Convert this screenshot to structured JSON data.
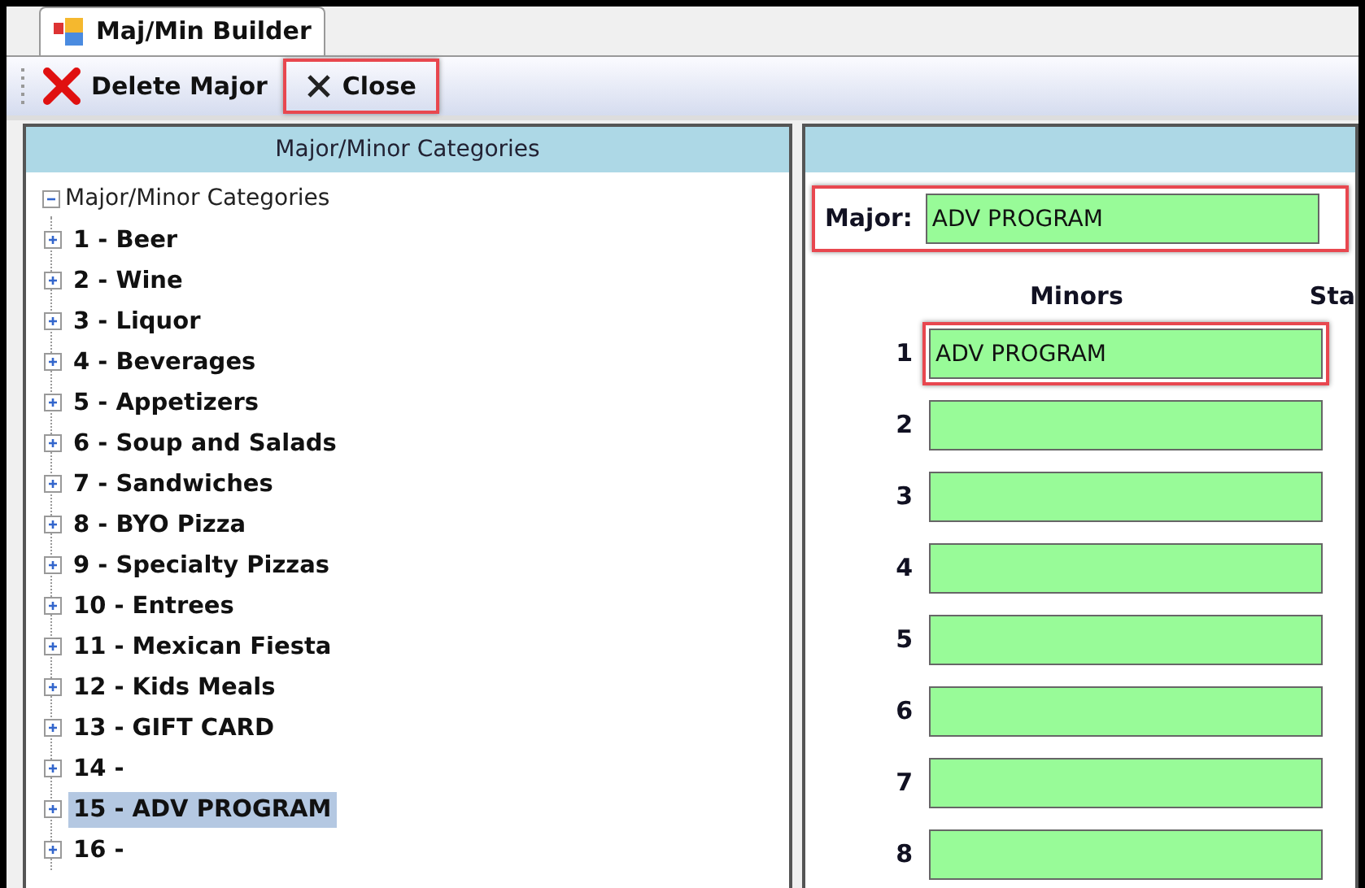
{
  "window": {
    "tab": {
      "title": "Maj/Min Builder",
      "selected": true
    }
  },
  "toolbar": {
    "buttons": [
      {
        "label": "Delete Major",
        "kind": "delete",
        "highlighted": false
      },
      {
        "label": "Close",
        "kind": "close",
        "highlighted": true
      }
    ]
  },
  "tree_panel": {
    "header": "Major/Minor Categories",
    "root": {
      "label": "Major/Minor Categories",
      "expanded": true,
      "children": [
        {
          "label": "1 - Beer",
          "expanded": false,
          "selected": false
        },
        {
          "label": "2 - Wine",
          "expanded": false,
          "selected": false
        },
        {
          "label": "3 - Liquor",
          "expanded": false,
          "selected": false
        },
        {
          "label": "4 - Beverages",
          "expanded": false,
          "selected": false
        },
        {
          "label": "5 - Appetizers",
          "expanded": false,
          "selected": false
        },
        {
          "label": "6 - Soup and Salads",
          "expanded": false,
          "selected": false
        },
        {
          "label": "7 - Sandwiches",
          "expanded": false,
          "selected": false
        },
        {
          "label": "8 - BYO Pizza",
          "expanded": false,
          "selected": false
        },
        {
          "label": "9 - Specialty Pizzas",
          "expanded": false,
          "selected": false
        },
        {
          "label": "10 - Entrees",
          "expanded": false,
          "selected": false
        },
        {
          "label": "11 - Mexican Fiesta",
          "expanded": false,
          "selected": false
        },
        {
          "label": "12 - Kids Meals",
          "expanded": false,
          "selected": false
        },
        {
          "label": "13 - GIFT CARD",
          "expanded": false,
          "selected": false
        },
        {
          "label": "14 -",
          "expanded": false,
          "selected": false
        },
        {
          "label": "15 - ADV PROGRAM",
          "expanded": false,
          "selected": true
        },
        {
          "label": "16 -",
          "expanded": false,
          "selected": false
        }
      ]
    }
  },
  "editor_panel": {
    "major": {
      "label": "Major:",
      "value": "ADV PROGRAM",
      "highlighted": true
    },
    "columns": [
      "Minors",
      "Sta"
    ],
    "minors": [
      {
        "number": "1",
        "value": "ADV PROGRAM",
        "highlighted": true
      },
      {
        "number": "2",
        "highlighted": false
      },
      {
        "number": "3",
        "highlighted": false
      },
      {
        "number": "4",
        "highlighted": false
      },
      {
        "number": "5",
        "highlighted": false
      },
      {
        "number": "6",
        "highlighted": false
      },
      {
        "number": "7",
        "highlighted": false
      },
      {
        "number": "8",
        "highlighted": false
      }
    ]
  }
}
